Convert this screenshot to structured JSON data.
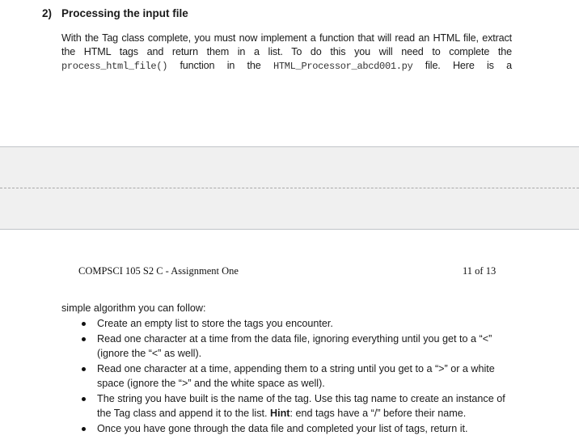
{
  "section": {
    "number": "2)",
    "title": "Processing the input file"
  },
  "intro_paragraph": {
    "line1": "With the Tag class complete, you must now implement a function that will read an HTML file, extract",
    "line2": "the HTML tags and return them in a list. To do this you will need to complete the",
    "line3_code1": "process_html_file()",
    "line3_mid": " function in the ",
    "line3_code2": "HTML_Processor_abcd001.py",
    "line3_end": " file. Here is a"
  },
  "footer": {
    "course": "COMPSCI 105 S2 C - Assignment One",
    "page_indicator": "11 of 13"
  },
  "continuation": "simple algorithm you can follow:",
  "bullets": [
    {
      "text": "Create an empty list to store the tags you encounter."
    },
    {
      "text": "Read one character at a time from the data file, ignoring everything until you get to a “<” (ignore the “<” as well)."
    },
    {
      "text": "Read one character at a time, appending them to a string until you get to a “>” or a white space (ignore the “>” and the white space as well)."
    },
    {
      "text_before": "The string you have built is the name of the tag. Use this tag name to create an instance of the Tag class and append it to the list. ",
      "hint_label": "Hint",
      "text_after": ": end tags have a “/” before their name."
    },
    {
      "text": "Once you have gone through the data file and completed your list of tags, return it."
    }
  ]
}
